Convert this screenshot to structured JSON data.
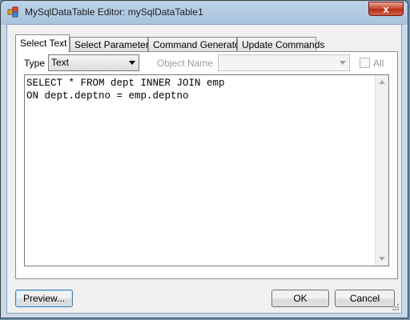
{
  "window": {
    "title": "MySqlDataTable Editor: mySqlDataTable1",
    "close_label": "x"
  },
  "tabs": [
    {
      "label": "Select Text",
      "active": true
    },
    {
      "label": "Select Parameters",
      "active": false
    },
    {
      "label": "Command Generator",
      "active": false
    },
    {
      "label": "Update Commands",
      "active": false
    }
  ],
  "panel": {
    "type_label": "Type",
    "type_value": "Text",
    "object_name_label": "Object Name",
    "object_name_value": "",
    "all_label": "All",
    "all_checked": false,
    "sql_lines": [
      "SELECT * FROM dept INNER JOIN emp",
      "ON dept.deptno = emp.deptno"
    ]
  },
  "buttons": {
    "preview": "Preview...",
    "ok": "OK",
    "cancel": "Cancel"
  },
  "colors": {
    "titlebar": "#a9c3dd",
    "close": "#c8452e",
    "focus_border": "#3c7fb1"
  }
}
